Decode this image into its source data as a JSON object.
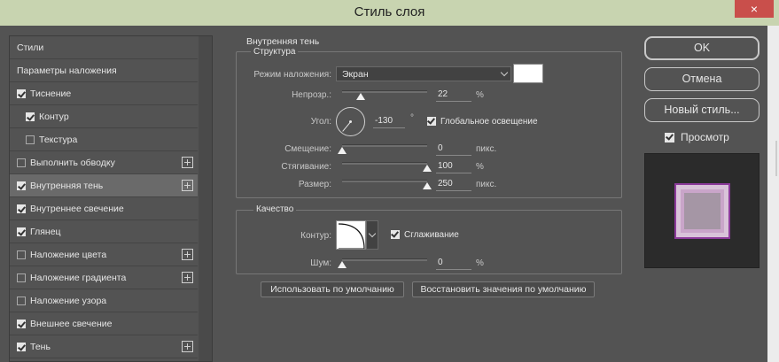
{
  "window": {
    "title": "Стиль слоя",
    "close_glyph": "×"
  },
  "styles_panel": {
    "items": [
      {
        "label": "Стили",
        "checkbox": null,
        "plus": false,
        "indent": 0
      },
      {
        "label": "Параметры наложения",
        "checkbox": null,
        "plus": false,
        "indent": 0
      },
      {
        "label": "Тиснение",
        "checkbox": true,
        "plus": false,
        "indent": 0
      },
      {
        "label": "Контур",
        "checkbox": true,
        "plus": false,
        "indent": 1
      },
      {
        "label": "Текстура",
        "checkbox": false,
        "plus": false,
        "indent": 1
      },
      {
        "label": "Выполнить обводку",
        "checkbox": false,
        "plus": true,
        "indent": 0
      },
      {
        "label": "Внутренняя тень",
        "checkbox": true,
        "plus": true,
        "indent": 0,
        "active": true
      },
      {
        "label": "Внутреннее свечение",
        "checkbox": true,
        "plus": false,
        "indent": 0
      },
      {
        "label": "Глянец",
        "checkbox": true,
        "plus": false,
        "indent": 0
      },
      {
        "label": "Наложение цвета",
        "checkbox": false,
        "plus": true,
        "indent": 0
      },
      {
        "label": "Наложение градиента",
        "checkbox": false,
        "plus": true,
        "indent": 0
      },
      {
        "label": "Наложение узора",
        "checkbox": false,
        "plus": false,
        "indent": 0
      },
      {
        "label": "Внешнее свечение",
        "checkbox": true,
        "plus": false,
        "indent": 0
      },
      {
        "label": "Тень",
        "checkbox": true,
        "plus": true,
        "indent": 0
      }
    ]
  },
  "inner_shadow": {
    "section_title": "Внутренняя тень",
    "structure": {
      "group_label": "Структура",
      "blend_mode_label": "Режим наложения:",
      "blend_mode_value": "Экран",
      "shadow_color": "#ffffff",
      "opacity_label": "Непрозр.:",
      "opacity_value": "22",
      "opacity_unit": "%",
      "opacity_level": 0.22,
      "angle_label": "Угол:",
      "angle_value": "-130",
      "angle_unit": "°",
      "global_light_label": "Глобальное освещение",
      "global_light_checked": true,
      "distance_label": "Смещение:",
      "distance_value": "0",
      "distance_unit": "пикс.",
      "distance_level": 0.0,
      "choke_label": "Стягивание:",
      "choke_value": "100",
      "choke_unit": "%",
      "choke_level": 1.0,
      "size_label": "Размер:",
      "size_value": "250",
      "size_unit": "пикс.",
      "size_level": 1.0
    },
    "quality": {
      "group_label": "Качество",
      "contour_label": "Контур:",
      "antialias_label": "Сглаживание",
      "antialias_checked": true,
      "noise_label": "Шум:",
      "noise_value": "0",
      "noise_unit": "%",
      "noise_level": 0.0
    },
    "make_default_label": "Использовать по умолчанию",
    "reset_default_label": "Восстановить значения по умолчанию"
  },
  "actions": {
    "ok_label": "OK",
    "cancel_label": "Отмена",
    "new_style_label": "Новый стиль...",
    "preview_label": "Просмотр",
    "preview_checked": true
  },
  "colors": {
    "panel_bg": "#535353",
    "titlebar_bg": "#c8d4b0",
    "close_bg": "#c94f4b",
    "preview_accent": "#8b3a9a"
  }
}
